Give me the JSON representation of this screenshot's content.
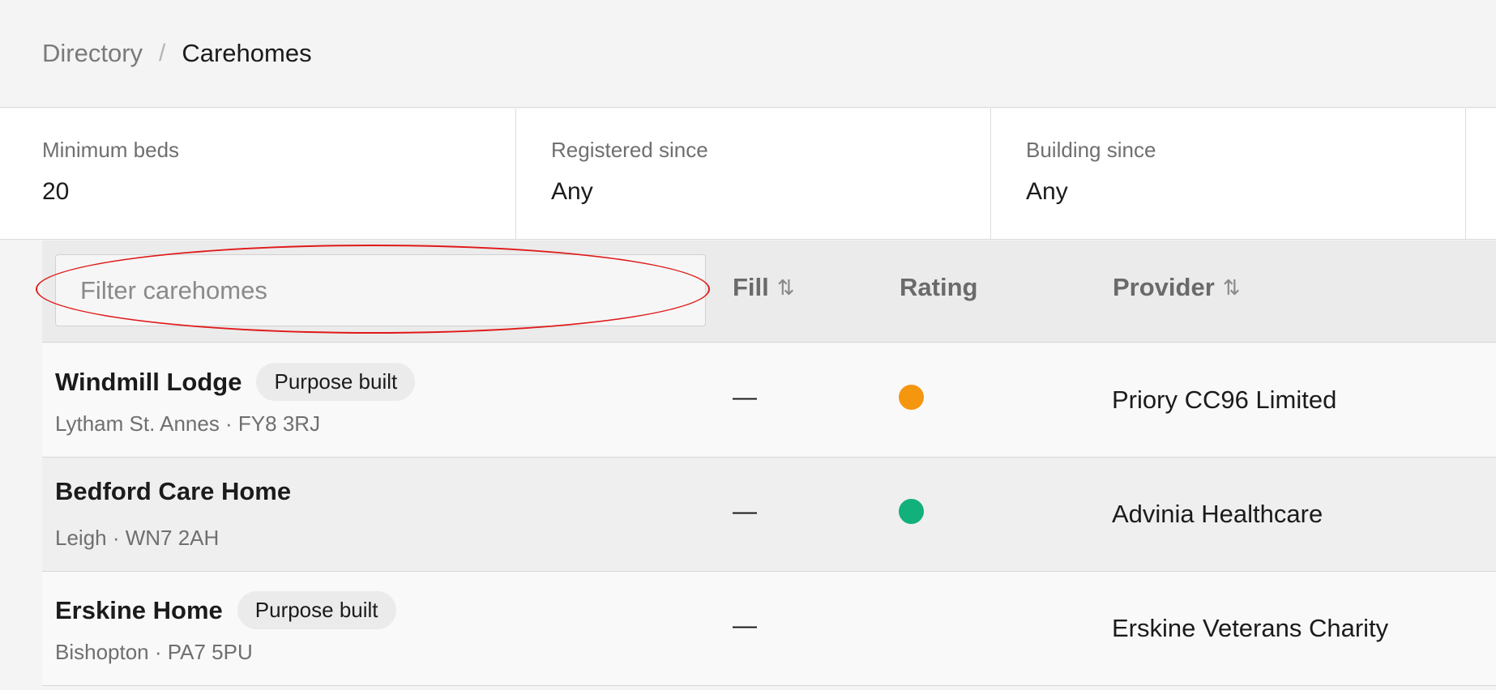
{
  "breadcrumb": {
    "parent": "Directory",
    "separator": "/",
    "current": "Carehomes"
  },
  "filters": [
    {
      "label": "Minimum beds",
      "value": "20"
    },
    {
      "label": "Registered since",
      "value": "Any"
    },
    {
      "label": "Building since",
      "value": "Any"
    }
  ],
  "table": {
    "search_placeholder": "Filter carehomes",
    "sort_icon": "⇅",
    "columns": {
      "fill": "Fill",
      "rating": "Rating",
      "provider": "Provider"
    },
    "rows": [
      {
        "name": "Windmill Lodge",
        "tag": "Purpose built",
        "location": "Lytham St. Annes · FY8 3RJ",
        "fill": "—",
        "rating_color": "#f5960f",
        "provider": "Priory CC96 Limited"
      },
      {
        "name": "Bedford Care Home",
        "tag": "",
        "location": "Leigh · WN7 2AH",
        "fill": "—",
        "rating_color": "#12b07a",
        "provider": "Advinia Healthcare"
      },
      {
        "name": "Erskine Home",
        "tag": "Purpose built",
        "location": "Bishopton · PA7 5PU",
        "fill": "—",
        "rating_color": "",
        "provider": "Erskine Veterans Charity"
      }
    ]
  },
  "colors": {
    "highlight": "#e01919",
    "rating_amber": "#f5960f",
    "rating_green": "#12b07a"
  },
  "icons": {
    "sort": "sort-arrows-icon",
    "rating": "rating-dot-icon"
  }
}
